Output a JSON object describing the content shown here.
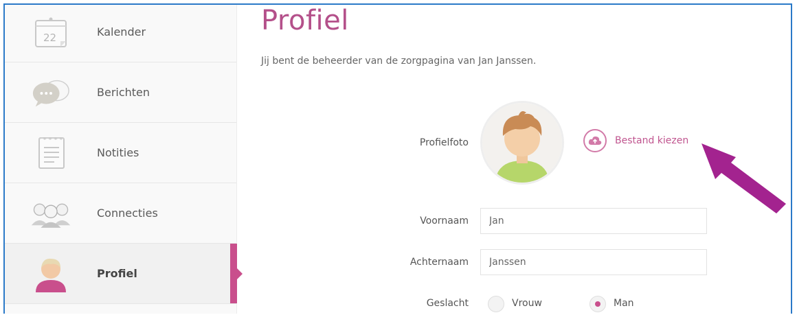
{
  "sidebar": {
    "items": [
      {
        "label": "Kalender",
        "icon": "calendar-icon",
        "badge": "22"
      },
      {
        "label": "Berichten",
        "icon": "chat-bubbles-icon"
      },
      {
        "label": "Notities",
        "icon": "notepad-icon"
      },
      {
        "label": "Connecties",
        "icon": "people-icon"
      },
      {
        "label": "Profiel",
        "icon": "profile-avatar-icon",
        "active": true
      }
    ]
  },
  "main": {
    "title": "Profiel",
    "subtitle": "Jij bent de beheerder van de zorgpagina van Jan Janssen.",
    "photo": {
      "label": "Profielfoto",
      "upload_label": "Bestand kiezen"
    },
    "first_name": {
      "label": "Voornaam",
      "value": "Jan"
    },
    "last_name": {
      "label": "Achternaam",
      "value": "Janssen"
    },
    "gender": {
      "label": "Geslacht",
      "options": [
        {
          "label": "Vrouw",
          "selected": false
        },
        {
          "label": "Man",
          "selected": true
        }
      ]
    }
  },
  "colors": {
    "accent": "#c94f8c",
    "title": "#b4508a",
    "annotation_arrow": "#a3238f",
    "frame": "#2a79c8"
  }
}
